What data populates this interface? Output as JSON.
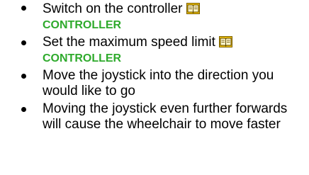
{
  "colors": {
    "text": "#000000",
    "reference": "#2eaa2c",
    "icon_fill": "#f5c400"
  },
  "items": [
    {
      "text": "Switch on the controller",
      "icon": "book-icon",
      "reference": "CONTROLLER"
    },
    {
      "text": "Set the maximum speed limit",
      "icon": "book-icon",
      "reference": "CONTROLLER"
    },
    {
      "text": "Move the joystick into the direction you would like to go"
    },
    {
      "text": "Moving the joystick even further forwards will cause the wheelchair to move faster"
    }
  ]
}
